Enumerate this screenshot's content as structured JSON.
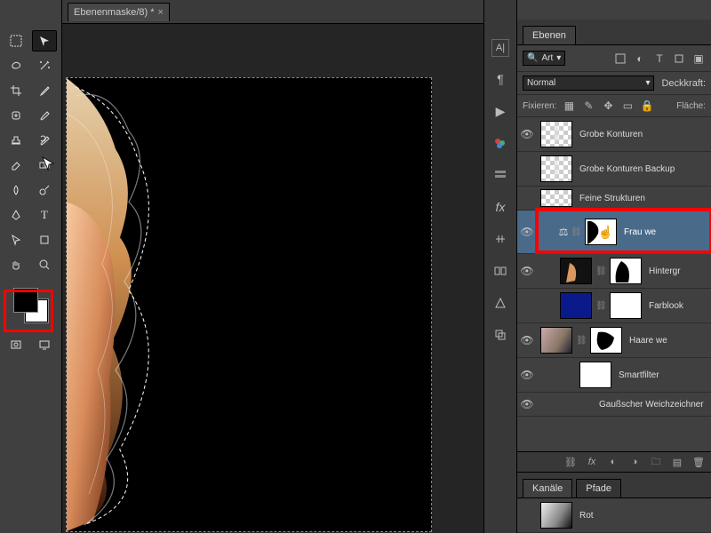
{
  "document": {
    "tab_title": "Ebenenmaske/8) *"
  },
  "panel_tabs": {
    "layers": "Ebenen",
    "channels": "Kanäle",
    "paths": "Pfade"
  },
  "filter_row": {
    "kind": "Art"
  },
  "blend_row": {
    "mode": "Normal",
    "opacity_label": "Deckkraft:"
  },
  "lock_row": {
    "label": "Fixieren:",
    "fill_label": "Fläche:"
  },
  "layers": [
    {
      "name": "Grobe Konturen"
    },
    {
      "name": "Grobe Konturen Backup"
    },
    {
      "name": "Feine Strukturen"
    },
    {
      "name": "Frau we"
    },
    {
      "name": "Hintergr"
    },
    {
      "name": "Farblook"
    },
    {
      "name": "Haare we"
    },
    {
      "name": "Smartfilter"
    },
    {
      "name": "Gaußscher Weichzeichner"
    }
  ],
  "channels": {
    "first": "Rot"
  },
  "colors": {
    "fg": "#000000",
    "bg": "#ffffff",
    "highlight": "#ff0000",
    "selected_layer": "#4a6a8a"
  }
}
